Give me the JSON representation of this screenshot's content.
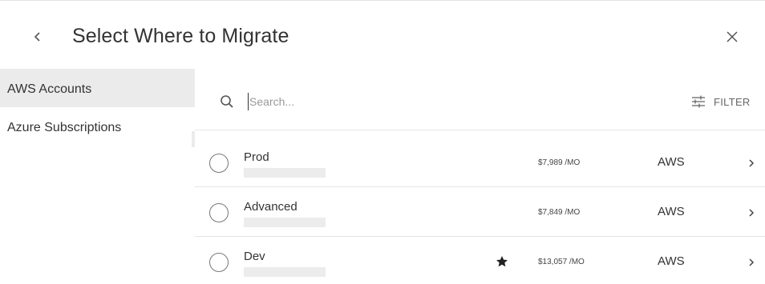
{
  "header": {
    "title": "Select Where to Migrate",
    "back_icon": "chevron-left-icon",
    "close_icon": "close-icon"
  },
  "sidebar": {
    "items": [
      {
        "label": "AWS Accounts",
        "active": true
      },
      {
        "label": "Azure Subscriptions",
        "active": false
      }
    ]
  },
  "search": {
    "placeholder": "Search...",
    "value": "",
    "icon": "search-icon"
  },
  "filter": {
    "label": "FILTER",
    "icon": "filter-sliders-icon"
  },
  "rows": [
    {
      "name": "Prod",
      "price": "$7,989 /MO",
      "cloud": "AWS",
      "starred": false
    },
    {
      "name": "Advanced",
      "price": "$7,849 /MO",
      "cloud": "AWS",
      "starred": false
    },
    {
      "name": "Dev",
      "price": "$13,057 /MO",
      "cloud": "AWS",
      "starred": true
    }
  ],
  "colors": {
    "active_sidebar_bg": "#ebebeb",
    "text": "#333333",
    "divider": "#e4e4e4"
  }
}
